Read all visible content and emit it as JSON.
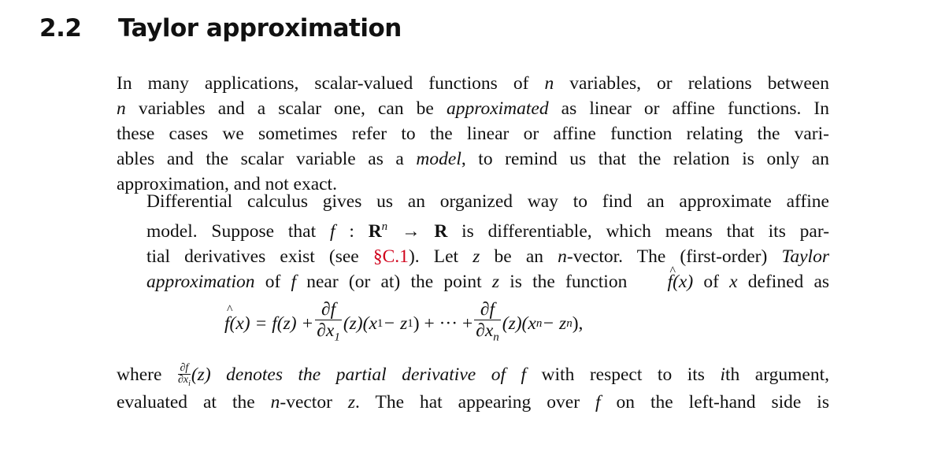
{
  "section": {
    "number": "2.2",
    "title": "Taylor approximation"
  },
  "paragraph1": {
    "lines": [
      [
        "In many applications, scalar-valued functions of ",
        "n",
        " variables, or relations between"
      ],
      [
        "",
        "n",
        " variables and a scalar one, can be ",
        "approximated",
        " as linear or affine functions.  In"
      ],
      [
        "these cases we sometimes refer to the linear or affine function relating the vari-"
      ],
      [
        "ables and the scalar variable as a ",
        "model",
        ", to remind us that the relation is only an"
      ],
      [
        "approximation, and not exact."
      ]
    ]
  },
  "paragraph2": {
    "l1": "Differential calculus gives us an organized way to find an approximate affine",
    "l2a": "model.  Suppose that ",
    "l2f": "f",
    "l2b": " : ",
    "l2R": "R",
    "l2n": "n",
    "l2arrow": " → ",
    "l2R2": "R",
    "l2c": " is differentiable, which means that its par-",
    "l3a": "tial derivatives exist (see ",
    "l3ref": "§C.1",
    "l3b": ").  Let ",
    "l3z": "z",
    "l3c": " be an ",
    "l3n": "n",
    "l3d": "-vector.  The (first-order) ",
    "l3taylor": "Taylor",
    "l4approx": "approximation",
    "l4a": " of ",
    "l4f": "f",
    "l4b": " near (or at) the point ",
    "l4z": "z",
    "l4c": " is the function ",
    "l4fhat": "f",
    "l4x": "(x)",
    "l4d": " of ",
    "l4x2": "x",
    "l4e": " defined as"
  },
  "equation": {
    "lhs": "f",
    "lhs_arg": "(x) = f(z) + ",
    "frac1_num": "∂f",
    "frac1_den": "∂x",
    "frac1_sub": "1",
    "term1": "(z)(x",
    "term1_sub": "1",
    "term1b": " − z",
    "term1_sub2": "1",
    "term1c": ") + ··· + ",
    "frac2_num": "∂f",
    "frac2_den": "∂x",
    "frac2_sub": "n",
    "term2": "(z)(x",
    "term2_sub": "n",
    "term2b": " − z",
    "term2_sub2": "n",
    "term2c": "),"
  },
  "paragraph3": {
    "where": "where ",
    "sfrac_num": "∂f",
    "sfrac_den": "∂x",
    "sfrac_sub": "i",
    "l1a": "(z) denotes the partial derivative of ",
    "l1f": "f",
    "l1b": " with respect to its ",
    "l1i": "i",
    "l1c": "th argument,",
    "l2a": "evaluated at the ",
    "l2n": "n",
    "l2b": "-vector ",
    "l2z": "z",
    "l2c": ".  The hat appearing over ",
    "l2f": "f",
    "l2d": " on the left-hand side is"
  },
  "colors": {
    "text": "#111111",
    "reference_link": "#d0021b",
    "background": "#ffffff"
  }
}
